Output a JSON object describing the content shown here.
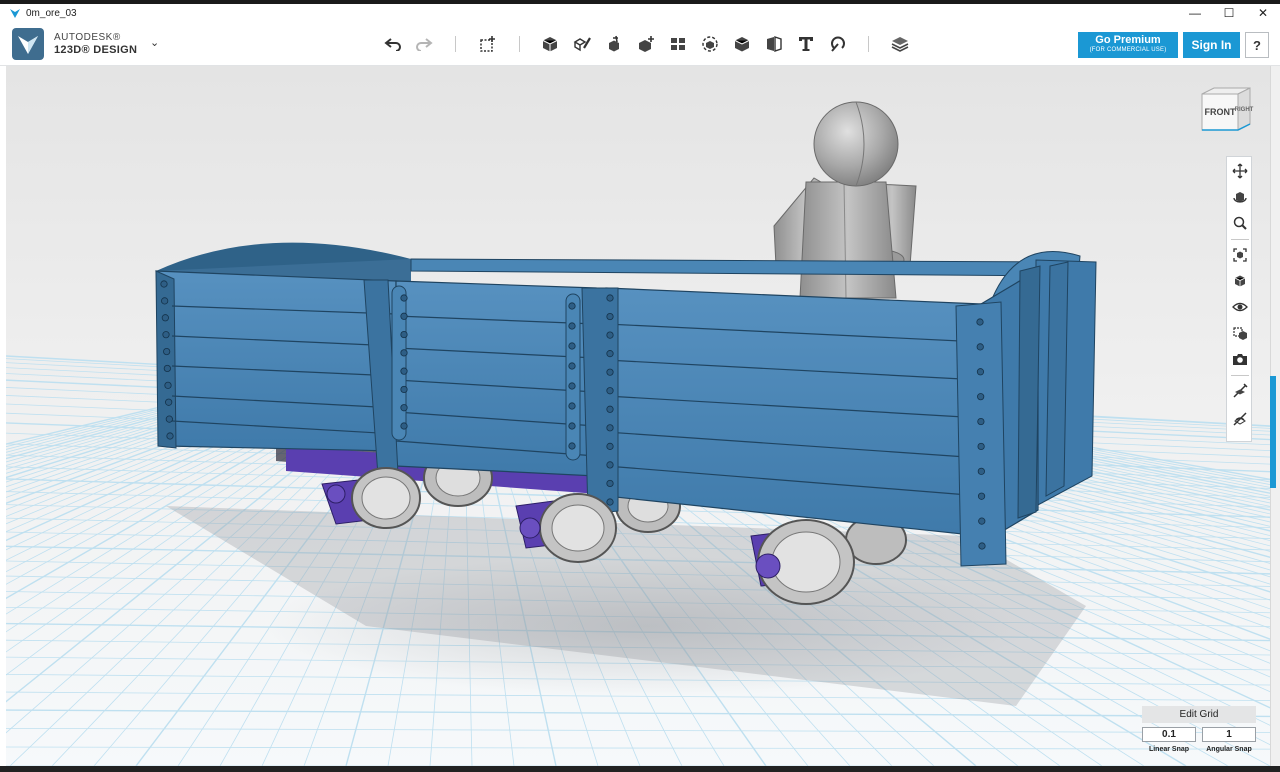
{
  "window": {
    "title": "0m_ore_03",
    "minimize_glyph": "—",
    "maximize_glyph": "☐",
    "close_glyph": "✕"
  },
  "app": {
    "brand_line1": "AUTODESK®",
    "brand_line2": "123D® DESIGN",
    "menu_chevron": "⌄"
  },
  "toolbar": {
    "undo_icon": "undo-icon",
    "redo_icon": "redo-icon",
    "tools": [
      "primitives",
      "sketch",
      "construct",
      "modify",
      "pattern",
      "grouping",
      "combine",
      "measure",
      "text",
      "snap",
      "material"
    ]
  },
  "account": {
    "premium_label": "Go Premium",
    "premium_sublabel": "(FOR COMMERCIAL USE)",
    "signin_label": "Sign In",
    "help_label": "?"
  },
  "viewcube": {
    "front_label": "FRONT",
    "right_label": "RIGHT"
  },
  "nav_tools": [
    "pan",
    "orbit",
    "zoom",
    "fit",
    "views",
    "visibility",
    "materials-outline",
    "screenshot",
    "edit-grid-tool",
    "snap-tool"
  ],
  "grid": {
    "edit_label": "Edit Grid",
    "linear_value": "0.1",
    "angular_value": "1",
    "linear_label": "Linear Snap",
    "angular_label": "Angular Snap"
  },
  "colors": {
    "accent": "#1b98d4",
    "wagon_blue": "#4a86b5",
    "wagon_dark": "#2f6288",
    "chassis_purple": "#5a3fb0",
    "grid_line": "#bfe0f0",
    "background_top": "#e6e6e6"
  }
}
